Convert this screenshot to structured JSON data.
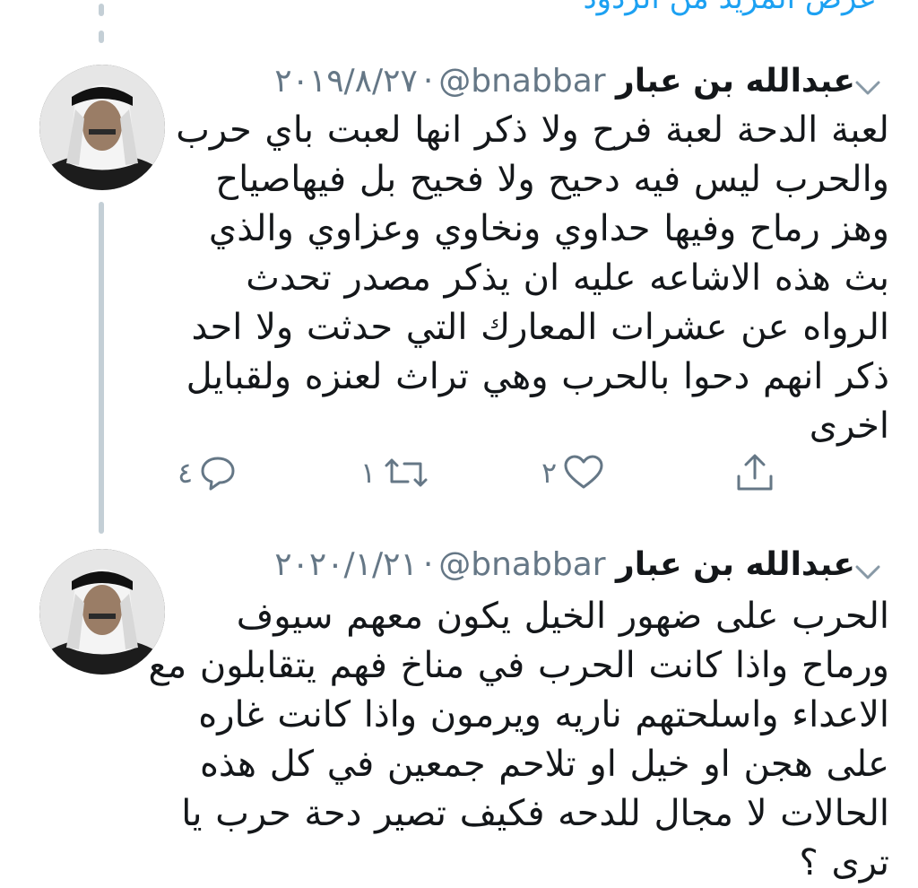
{
  "show_more_replies": "عرض المزيد من الردود",
  "tweets": [
    {
      "name": "عبدالله بن عبار",
      "handle": "@bnabbar",
      "separator": "·",
      "date": "٢٠١٩/٨/٢٧",
      "lines": [
        "لعبة الدحة لعبة فرح ولا ذكر انها لعبت باي حرب",
        "والحرب ليس فيه دحيح ولا فحيح بل فيهاصياح",
        "وهز رماح وفيها حداوي ونخاوي وعزاوي والذي",
        "بث هذه الاشاعه عليه ان يذكر مصدر تحدث",
        "الرواه عن عشرات المعارك التي حدثت ولا احد",
        "ذكر انهم دحوا بالحرب وهي تراث لعنزه ولقبايل",
        "اخرى"
      ],
      "reply_count": "٤",
      "retweet_count": "١",
      "like_count": "٢"
    },
    {
      "name": "عبدالله بن عبار",
      "handle": "@bnabbar",
      "separator": "·",
      "date": "٢٠٢٠/١/٢١",
      "lines": [
        "الحرب على ضهور الخيل يكون معهم سيوف",
        "ورماح واذا كانت الحرب في مناخ فهم يتقابلون مع",
        "الاعداء واسلحتهم ناريه ويرمون واذا كانت غاره",
        "على هجن او خيل او تلاحم جمعين في كل هذه",
        "الحالات لا مجال للدحه فكيف تصير دحة حرب يا",
        "ترى ؟"
      ]
    }
  ],
  "colors": {
    "accent": "#1da1f2",
    "secondary_text": "#657786",
    "thread_line": "#c4cfd6"
  },
  "icons": {
    "reply": "speech-bubble-icon",
    "retweet": "retweet-arrows-icon",
    "like": "heart-icon",
    "share": "share-upload-icon",
    "menu": "chevron-down-icon"
  }
}
